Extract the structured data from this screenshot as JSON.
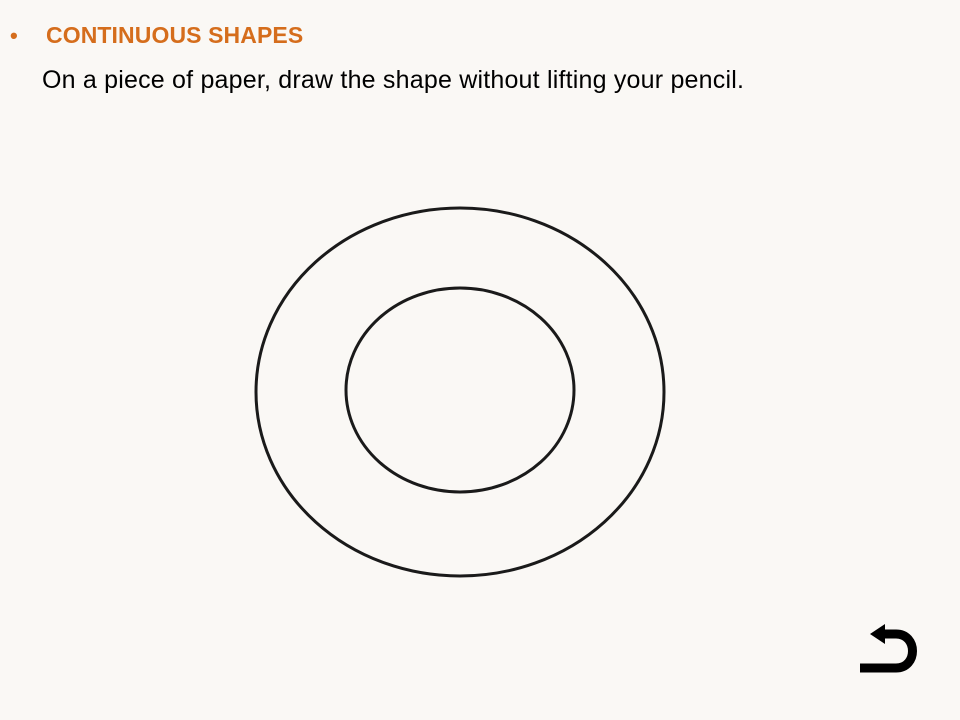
{
  "slide": {
    "bullet": "•",
    "heading": "CONTINUOUS SHAPES",
    "instruction": "On a piece of paper, draw the shape without lifting your pencil."
  },
  "shape": {
    "type": "two-concentric-ellipses",
    "stroke_color": "#1a1a1a"
  },
  "navigation": {
    "back_icon": "return-arrow-icon"
  },
  "colors": {
    "accent": "#d56d1c",
    "background": "#faf8f5",
    "text": "#000000"
  }
}
